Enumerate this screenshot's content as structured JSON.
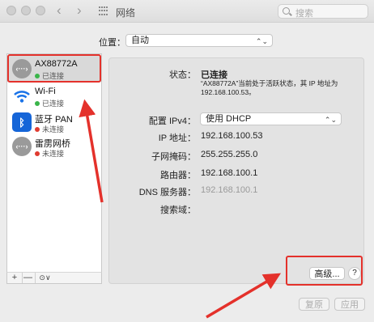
{
  "window": {
    "title": "网络",
    "search_placeholder": "搜索"
  },
  "location": {
    "label": "位置：",
    "value": "自动"
  },
  "services": [
    {
      "name": "AX88772A",
      "status": "已连接",
      "status_color": "#3ab54a",
      "icon": "ethernet-icon",
      "icon_text": "‹···›",
      "selected": true
    },
    {
      "name": "Wi-Fi",
      "status": "已连接",
      "status_color": "#3ab54a",
      "icon": "wifi-icon"
    },
    {
      "name": "蓝牙 PAN",
      "status": "未连接",
      "status_color": "#e03b30",
      "icon": "bluetooth-icon",
      "icon_text": "ᛒ"
    },
    {
      "name": "雷雳网桥",
      "status": "未连接",
      "status_color": "#e03b30",
      "icon": "thunderbolt-bridge-icon",
      "icon_text": "‹···›"
    }
  ],
  "sidebar_controls": {
    "add": "+",
    "remove": "—",
    "actions": "⊙∨"
  },
  "detail": {
    "status_label": "状态：",
    "status_value": "已连接",
    "status_desc_1": "“AX88772A”当前处于活跃状态，其 IP 地址为",
    "status_desc_2": "192.168.100.53。",
    "ipv4_config_label": "配置 IPv4：",
    "ipv4_config_value": "使用 DHCP",
    "ip_label": "IP 地址：",
    "ip_value": "192.168.100.53",
    "subnet_label": "子网掩码：",
    "subnet_value": "255.255.255.0",
    "router_label": "路由器：",
    "router_value": "192.168.100.1",
    "dns_label": "DNS 服务器：",
    "dns_value": "192.168.100.1",
    "search_domain_label": "搜索域："
  },
  "buttons": {
    "advanced": "高级...",
    "help": "?",
    "revert": "复原",
    "apply": "应用"
  },
  "annotation_color": "#e4312b"
}
